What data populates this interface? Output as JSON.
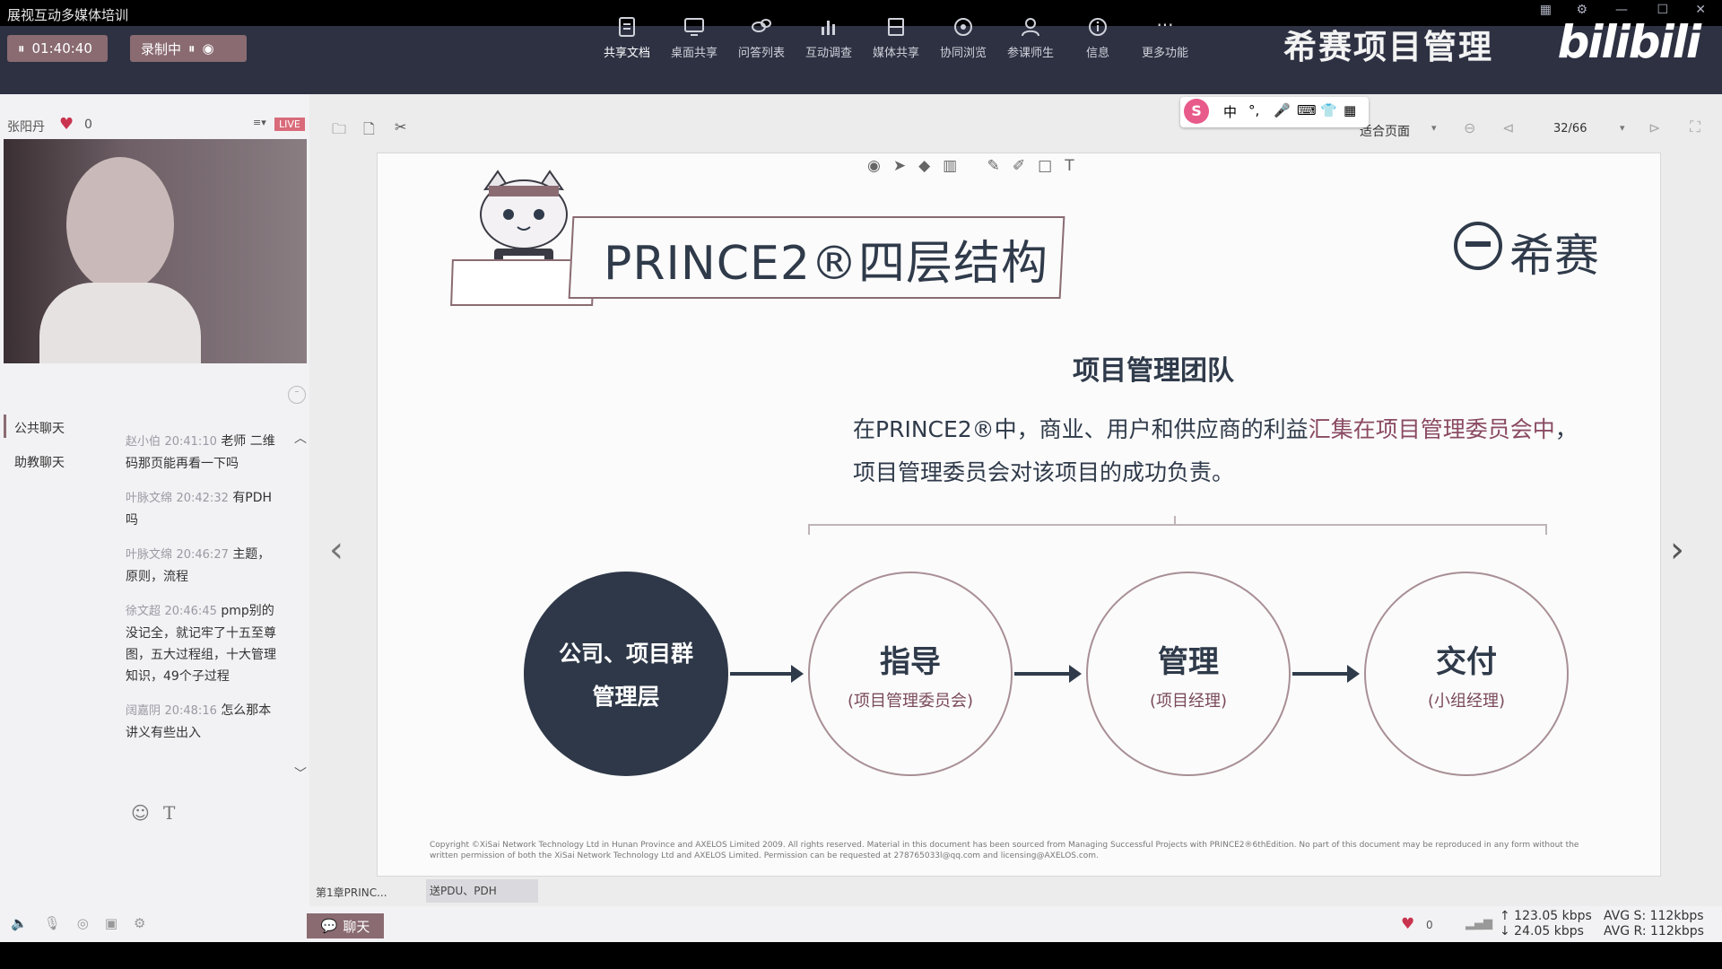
{
  "app": {
    "title": "展视互动多媒体培训",
    "timer": "01:40:40",
    "recording": "录制中"
  },
  "toolbar": {
    "items": [
      {
        "label": "共享文档",
        "icon": "document-icon"
      },
      {
        "label": "桌面共享",
        "icon": "monitor-icon"
      },
      {
        "label": "问答列表",
        "icon": "chat-bubbles-icon"
      },
      {
        "label": "互动调查",
        "icon": "bar-chart-icon"
      },
      {
        "label": "媒体共享",
        "icon": "film-icon"
      },
      {
        "label": "协同浏览",
        "icon": "compass-icon"
      },
      {
        "label": "参课师生",
        "icon": "people-icon"
      },
      {
        "label": "信息",
        "icon": "info-icon"
      },
      {
        "label": "更多功能",
        "icon": "more-icon"
      }
    ],
    "brand": "希赛项目管理",
    "bili": "bilibili"
  },
  "presenter": {
    "name": "张阳丹",
    "likes": "0",
    "live": "LIVE"
  },
  "chat": {
    "tabs": [
      "公共聊天",
      "助教聊天"
    ],
    "messages": [
      {
        "name": "赵小伯",
        "time": "20:41:10",
        "text": "老师 二维码那页能再看一下吗"
      },
      {
        "name": "叶脉文绵",
        "time": "20:42:32",
        "text": "有PDH吗"
      },
      {
        "name": "叶脉文绵",
        "time": "20:46:27",
        "text": "主题，原则，流程"
      },
      {
        "name": "徐文超",
        "time": "20:46:45",
        "text": "pmp别的没记全，就记牢了十五至尊图，五大过程组，十大管理知识，49个子过程"
      },
      {
        "name": "阔嘉阴",
        "time": "20:48:16",
        "text": "怎么那本讲义有些出入"
      }
    ]
  },
  "doc": {
    "fit_label": "适合页面",
    "page": "32/66"
  },
  "slide": {
    "title": "PRINCE2®四层结构",
    "logo_text": "希赛",
    "heading": "项目管理团队",
    "desc_line1_a": "在PRINCE2®中，商业、用户和供应商的利益",
    "desc_line1_b": "汇集在项目管理委员会中",
    "desc_line1_c": "，",
    "desc_line2": "项目管理委员会对该项目的成功负责。",
    "nodes": [
      {
        "title": "公司、项目群",
        "title2": "管理层",
        "sub": ""
      },
      {
        "title": "指导",
        "sub": "(项目管理委员会)"
      },
      {
        "title": "管理",
        "sub": "(项目经理)"
      },
      {
        "title": "交付",
        "sub": "(小组经理)"
      }
    ],
    "copyright1": "Copyright ©XiSai Network Technology Ltd in Hunan Province and AXELOS Limited 2009. All rights reserved. Material in this document has been sourced from Managing Successful Projects with PRINCE2®6thEdition. No part of this document may be reproduced in any form without the",
    "copyright2": "written permission of both the XiSai Network Technology Ltd and AXELOS Limited. Permission can be requested at 278765033l@qq.com and licensing@AXELOS.com."
  },
  "bottom": {
    "chapter": "第1章PRINC...",
    "file": "送PDU、PDH",
    "chat_button": "聊天",
    "likes": "0",
    "up": "↑ 123.05 kbps",
    "down": "↓ 24.05 kbps",
    "avg_s": "AVG S: 112kbps",
    "avg_r": "AVG R: 112kbps"
  }
}
